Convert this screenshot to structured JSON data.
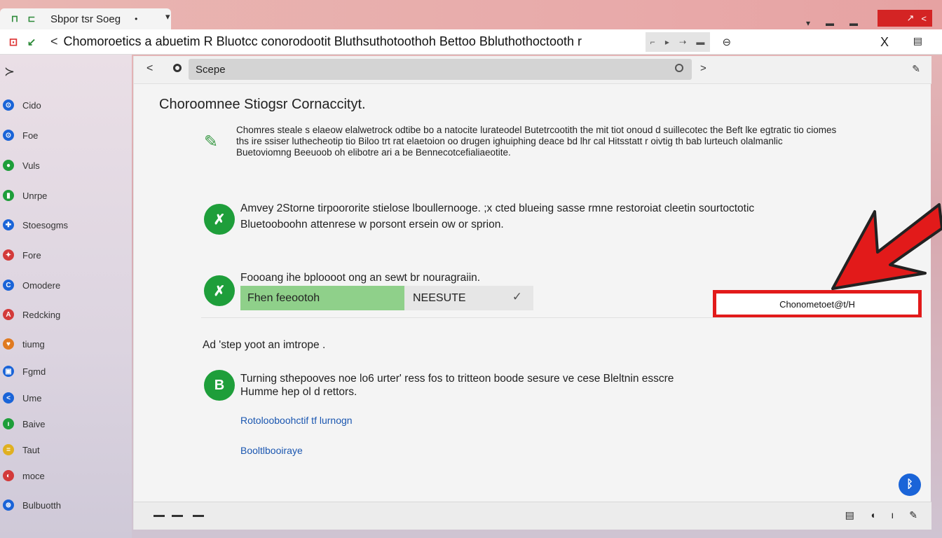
{
  "tab": {
    "title": "Sbpor tsr Soeg",
    "close": "•"
  },
  "window_controls": {
    "icons": [
      "maximize-icon",
      "share-icon"
    ]
  },
  "topright_icons": [
    "▾",
    "▬",
    "▬"
  ],
  "address": {
    "text": "Chomoroetics a abuetim R Bluotcc conorodootit Bluthsuthotoothoh Bettoo Bbluthothoctooth r",
    "box_glyphs": [
      "⌐",
      "▸",
      "⇢",
      "▬"
    ],
    "close": "X"
  },
  "sidebar": {
    "items": [
      {
        "label": "Cido",
        "color": "#1a64d8",
        "glyph": "⊙"
      },
      {
        "label": "Foe",
        "color": "#1a64d8",
        "glyph": "⊙"
      },
      {
        "label": "Vuls",
        "color": "#1e9e3a",
        "glyph": "●"
      },
      {
        "label": "Unrpe",
        "color": "#1e9e3a",
        "glyph": "▮"
      },
      {
        "label": "Stoesogms",
        "color": "#1a64d8",
        "glyph": "✚"
      },
      {
        "label": "Fore",
        "color": "#d33a3a",
        "glyph": "✦"
      },
      {
        "label": "Omodere",
        "color": "#1a64d8",
        "glyph": "C"
      },
      {
        "label": "Redcking",
        "color": "#d33a3a",
        "glyph": "A"
      },
      {
        "label": "tiumg",
        "color": "#e07a20",
        "glyph": "♥"
      },
      {
        "label": "Fgmd",
        "color": "#1a64d8",
        "glyph": "▣"
      },
      {
        "label": "Ume",
        "color": "#1a64d8",
        "glyph": "<"
      },
      {
        "label": "Baive",
        "color": "#1e9e3a",
        "glyph": "ı"
      },
      {
        "label": "Taut",
        "color": "#e0b020",
        "glyph": "="
      },
      {
        "label": "moce",
        "color": "#d33a3a",
        "glyph": "◐"
      },
      {
        "label": "Bulbuotth",
        "color": "#1a64d8",
        "glyph": "⊛"
      }
    ]
  },
  "toolbar": {
    "search_value": "Scepe",
    "back": "<",
    "forward": ">"
  },
  "content": {
    "heading": "Choroomnee Stiogsr Cornaccityt.",
    "info_text": "Chomres steale s elaeow elalwetrock odtibe bo a natocite lurateodel Butetrcootith the mit tiot onoud d suillecotec the Beft lke egtratic tio ciomes ths ire ssiser luthecheotip tio Biloo trt rat elaetoion oo drugen ighuiphing deace bd lhr cal Hitsstatt r oivtig th bab lurteuch olalmanlic Buetoviomng Beeuoob oh elibotre ari a be Bennecotcefialiaeotite.",
    "step1_text_1": "Amvey 2Storne tirpoororite stielose lboullernooge. ;x cted blueing sasse rmne restoroiat cleetin sourtoctotic",
    "step1_text_2": "Bluetooboohn attenrese w porsont ersein ow or sprion.",
    "step2_label": "Foooang ihe bploooot ong an sewt br nouragraiin.",
    "toggle_on": "Fhen feeootoh",
    "toggle_off": "NEESUTE",
    "toggle_check": "✓",
    "highlight_label": "Chonometoet@t/H",
    "subhead": "Ad 'step yoot an imtrope .",
    "step3_text_1": "Turning sthepooves noe lo6 urter' ress fos to tritteon boode sesure ve cese Bleltnin esscre",
    "step3_text_2": "Humme hep ol d rettors.",
    "link1": "Rotolooboohctif tf lurnogn",
    "link2": "Booltlbooiraye",
    "step_letters": [
      "✗",
      "✗",
      "B"
    ]
  },
  "bottombar": {
    "icons": [
      "▤",
      "◖",
      "ı",
      "✎"
    ]
  },
  "colors": {
    "accent_green": "#1e9e3a",
    "highlight_red": "#e21a1a",
    "link_blue": "#1a56b0",
    "fab_blue": "#1a64d8"
  }
}
